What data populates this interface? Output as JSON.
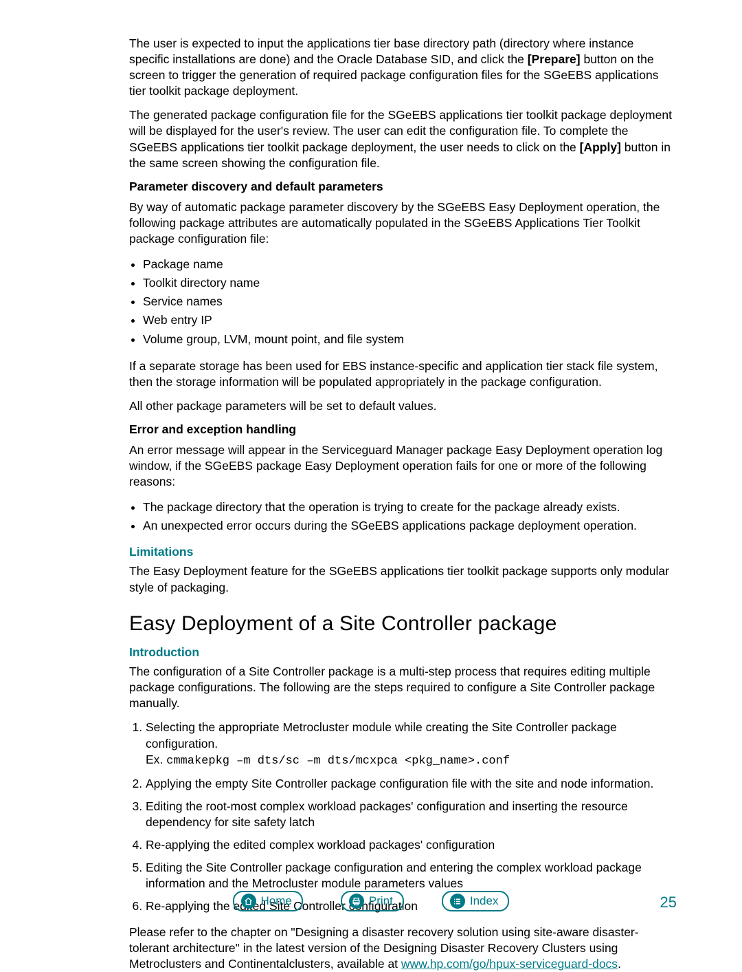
{
  "paragraphs": {
    "p1a": "The user is expected to input the applications tier base directory path (directory where instance specific installations are done) and the Oracle Database SID, and click the ",
    "p1_prepare": "[Prepare]",
    "p1b": " button on the screen to trigger the generation of required package configuration files for the SGeEBS applications tier toolkit package deployment.",
    "p2a": "The generated package configuration file for the SGeEBS applications tier toolkit package deployment will be displayed for the user's review. The user can edit the configuration file. To complete the SGeEBS applications tier toolkit package deployment, the user needs to click on the ",
    "p2_apply": "[Apply]",
    "p2b": " button in the same screen showing the configuration file.",
    "param_head": "Parameter discovery and default parameters",
    "p3": "By way of automatic package parameter discovery by the SGeEBS Easy Deployment operation, the following package attributes are automatically populated in the SGeEBS Applications Tier Toolkit package configuration file:",
    "p4": "If a separate storage has been used for EBS instance-specific and application tier stack file system, then the storage information will be populated appropriately in the package configuration.",
    "p5": "All other package parameters will be set to default values.",
    "err_head": "Error and exception handling",
    "p6": "An error message will appear in the Serviceguard Manager package Easy Deployment operation log window, if the SGeEBS package Easy Deployment operation fails for one or more of the following reasons:",
    "lim_head": "Limitations",
    "p7": "The Easy Deployment feature for the SGeEBS applications tier toolkit package supports only modular style of packaging.",
    "section_title": "Easy Deployment of a Site Controller package",
    "intro_head": "Introduction",
    "p8": "The configuration of a Site Controller package is a multi-step process that requires editing multiple package configurations. The following are the steps required to configure a Site Controller package manually.",
    "p9a": "Please refer to the chapter on \"Designing a disaster recovery solution using site-aware disaster-tolerant architecture\" in the latest version of the Designing Disaster Recovery Clusters using Metroclusters and Continentalclusters, available at ",
    "p9_link": "www.hp.com/go/hpux-serviceguard-docs",
    "p9b": "."
  },
  "bullets_params": [
    "Package name",
    "Toolkit directory name",
    "Service names",
    "Web entry IP",
    "Volume group, LVM, mount point, and file system"
  ],
  "bullets_errors": [
    "The package directory that the operation is trying to create for the package already exists.",
    "An unexpected error occurs during the SGeEBS applications package deployment operation."
  ],
  "steps": [
    {
      "text": "Selecting the appropriate Metrocluster module while creating the Site Controller package configuration.",
      "ex_label": "Ex. ",
      "ex_code": "cmmakepkg –m dts/sc –m dts/mcxpca <pkg_name>.conf"
    },
    {
      "text": "Applying the empty Site Controller package configuration file with the site and node information."
    },
    {
      "text": "Editing the root-most complex workload packages' configuration and inserting the resource dependency for site safety latch"
    },
    {
      "text": "Re-applying the edited complex workload packages' configuration"
    },
    {
      "text": "Editing the Site Controller package configuration and entering the complex workload package information and the Metrocluster module parameters values"
    },
    {
      "text": "Re-applying the edited Site Controller configuration"
    }
  ],
  "footer": {
    "home": "Home",
    "print": "Print",
    "index": "Index",
    "page_number": "25"
  }
}
